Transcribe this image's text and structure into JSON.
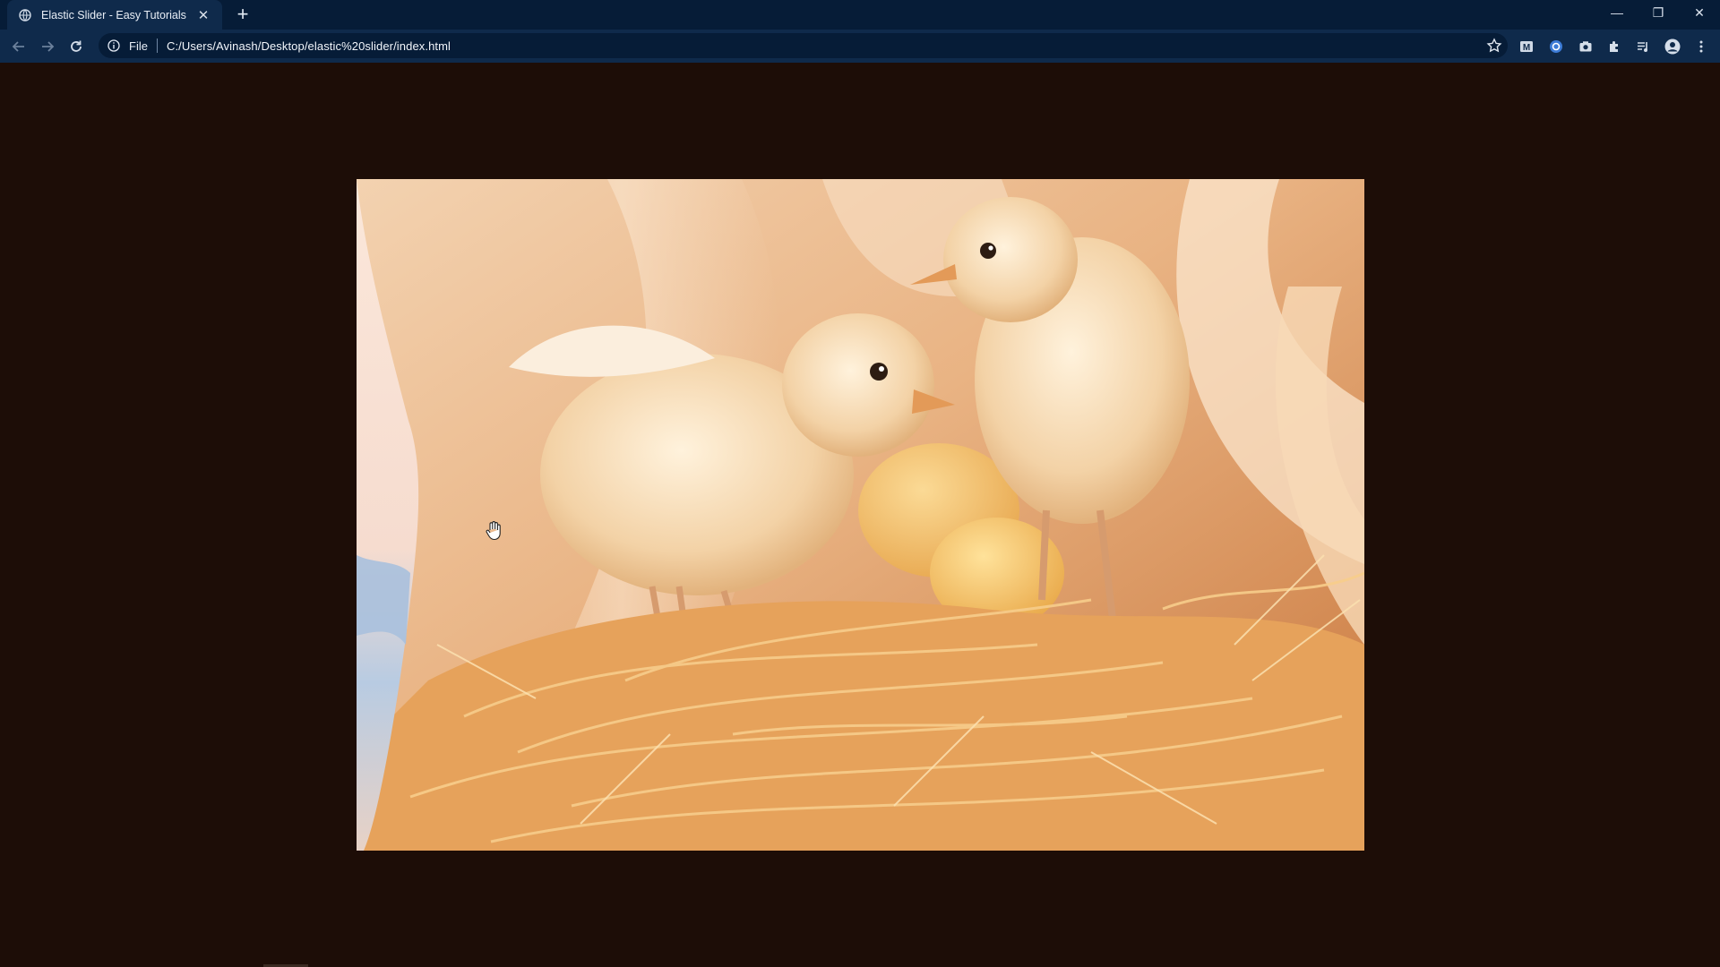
{
  "browser": {
    "tab_title": "Elastic Slider - Easy Tutorials",
    "tab_close": "✕",
    "new_tab": "+",
    "scheme_label": "File",
    "url": "C:/Users/Avinash/Desktop/elastic%20slider/index.html",
    "window_controls": {
      "minimize": "—",
      "restore": "❐",
      "close": "✕"
    },
    "extensions": [
      "mega-extension-icon",
      "vpn-extension-icon",
      "camera-extension-icon",
      "puzzle-extensions-icon",
      "media-control-icon",
      "profile-avatar-icon",
      "kebab-menu-icon"
    ]
  },
  "slider": {
    "current_image": "chicks-in-straw-nest",
    "next_image": "blue-sky-clouds",
    "transition": "elastic-wave"
  },
  "colors": {
    "page_background": "#1d0d07",
    "tabstrip": "#061c37",
    "toolbar": "#0f2a4b",
    "accent_orange": "#e59a52"
  }
}
